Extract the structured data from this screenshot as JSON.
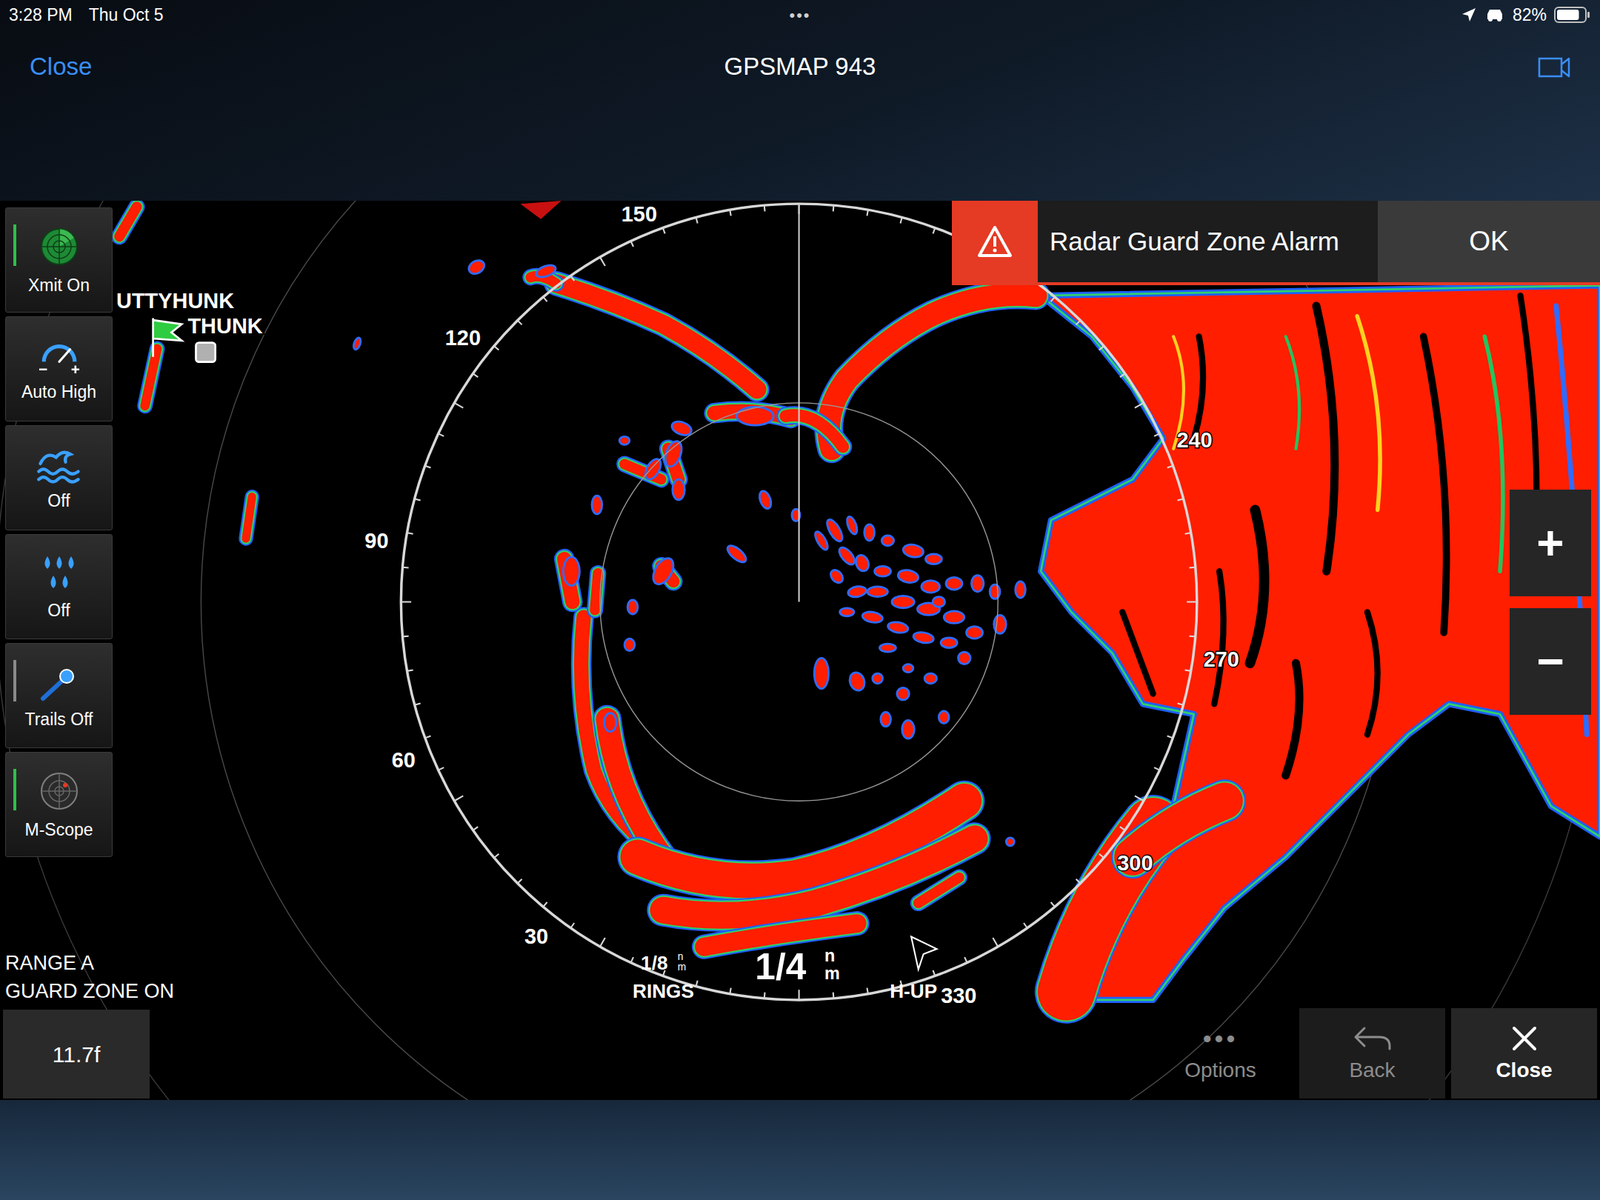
{
  "status_bar": {
    "time": "3:28 PM",
    "date": "Thu Oct 5",
    "dots": "•••",
    "battery": "82%",
    "battery_level": 0.82
  },
  "header": {
    "close": "Close",
    "title": "GPSMAP 943"
  },
  "tools": [
    {
      "label": "Xmit On",
      "kind": "radar",
      "toggle": true,
      "on": true
    },
    {
      "label": "Auto High",
      "kind": "gain",
      "toggle": false,
      "on": false
    },
    {
      "label": "Off",
      "kind": "sea",
      "toggle": false,
      "on": false
    },
    {
      "label": "Off",
      "kind": "rain",
      "toggle": false,
      "on": false
    },
    {
      "label": "Trails Off",
      "kind": "trails",
      "toggle": true,
      "on": false
    },
    {
      "label": "M-Scope",
      "kind": "mscope",
      "toggle": true,
      "on": true
    }
  ],
  "place_labels": [
    "UTTYHUNK",
    "THUNK"
  ],
  "bearings": [
    "150",
    "120",
    "90",
    "60",
    "30",
    "240",
    "270",
    "300",
    "330"
  ],
  "rings": {
    "value": "1/8",
    "unit_top": "n",
    "unit_bottom": "m",
    "label": "RINGS"
  },
  "range": {
    "value": "1/4",
    "unit_top": "n",
    "unit_bottom": "m"
  },
  "orientation": "H-UP",
  "status_text": [
    "RANGE A",
    "GUARD ZONE ON"
  ],
  "readout": "11.7f",
  "alarm": {
    "message": "Radar Guard Zone Alarm",
    "button": "OK"
  },
  "zoom": [
    "+",
    "−"
  ],
  "bottom_buttons": [
    {
      "label": "Options",
      "kind": "dots",
      "icon": "•••",
      "disabled": true
    },
    {
      "label": "Back",
      "kind": "back",
      "icon": "",
      "disabled": true
    },
    {
      "label": "Close",
      "kind": "close",
      "icon": "",
      "disabled": false
    }
  ]
}
